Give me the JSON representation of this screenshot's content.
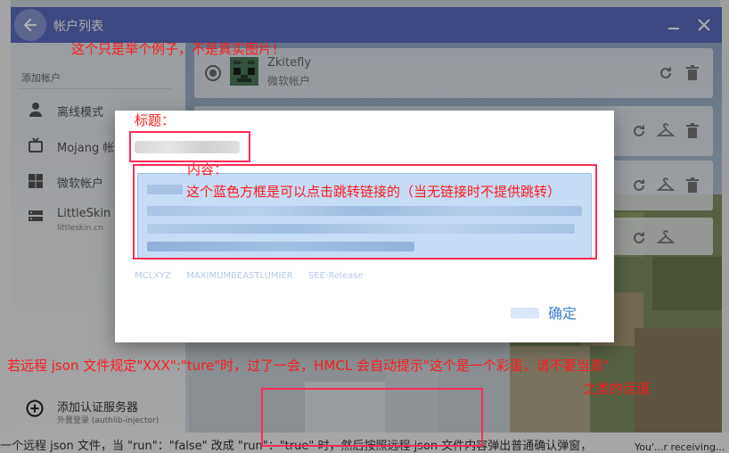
{
  "window": {
    "title": "帐户列表",
    "colors": {
      "titlebar": "#5c6bc0",
      "accent": "#3f7ec9",
      "annotation": "#ff1a1a"
    }
  },
  "sidebar": {
    "heading": "添加帐户",
    "items": [
      {
        "label": "离线模式",
        "icon": "person-icon"
      },
      {
        "label": "Mojang 帐户",
        "icon": "mojang-icon"
      },
      {
        "label": "微软帐户",
        "icon": "microsoft-icon"
      },
      {
        "label": "LittleSkin",
        "sub": "littleskin.cn",
        "icon": "server-icon"
      }
    ],
    "add_server": {
      "label": "添加认证服务器",
      "sub": "外置登录 (authlib-injector)",
      "icon": "plus-circle-icon"
    }
  },
  "accounts": [
    {
      "name": "Zkitefly",
      "type": "微软帐户"
    }
  ],
  "dialog": {
    "title_label": "标题：",
    "content_label": "内容：",
    "content_note": "这个蓝色方框是可以点击跳转链接的（当无链接时不提供跳转）",
    "link_labels": [
      "MCLXYZ",
      "MAXIMUMBEASTLUMIER",
      "SEE-Release"
    ],
    "ok_label": "确定"
  },
  "annotations": {
    "top": "这个只是举个例子，不是真实图片！",
    "bottom_line1": "若远程 json 文件规定\"XXX\":\"ture\"时，过了一会，HMCL 会自动提示\"这个是一个彩蛋，请不要当真\"",
    "bottom_line2": "之类的话语"
  },
  "background": {
    "bottom_text": "一个远程 json 文件，当 \"run\"：\"false\" 改成 \"run\"：\"true\" 时，然后按照远程 json 文件内容弹出普通确认弹窗，",
    "bottom_right_text": "You'...r receiving..."
  }
}
